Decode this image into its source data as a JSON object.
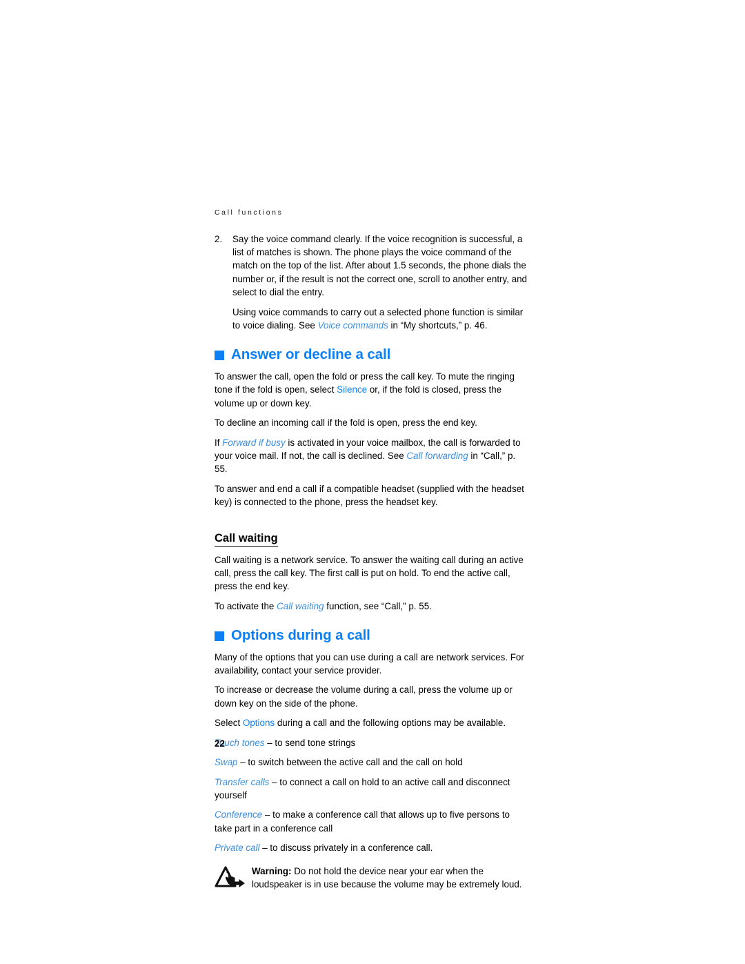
{
  "document": {
    "running_header": "Call functions",
    "page_number": "22"
  },
  "step": {
    "number": "2.",
    "paragraph_1": "Say the voice command clearly. If the voice recognition is successful, a list of matches is shown. The phone plays the voice command of the match on the top of the list. After about 1.5 seconds, the phone dials the number or, if the result is not the correct one, scroll to another entry, and select to dial the entry.",
    "paragraph_2_part1": "Using voice commands to carry out a selected phone function is similar to voice dialing. See ",
    "paragraph_2_term": "Voice commands",
    "paragraph_2_part2": " in “My shortcuts,” p. 46."
  },
  "answer_decline": {
    "heading": "Answer or decline a call",
    "p1_part1": "To answer the call, open the fold or press the call key. To mute the ringing tone if the fold is open, select ",
    "p1_term": "Silence",
    "p1_part2": " or, if the fold is closed, press the volume up or down key.",
    "p2": "To decline an incoming call if the fold is open, press the end key.",
    "p3_part1": "If ",
    "p3_term1": "Forward if busy",
    "p3_part2": " is activated in your voice mailbox, the call is forwarded to your voice mail. If not, the call is declined. See ",
    "p3_term2": "Call forwarding",
    "p3_part3": " in “Call,” p. 55.",
    "p4": "To answer and end a call if a compatible headset (supplied with the headset key) is connected to the phone, press the headset key."
  },
  "call_waiting": {
    "heading": "Call waiting",
    "p1": "Call waiting is a network service. To answer the waiting call during an active call, press the call key. The first call is put on hold. To end the active call, press the end key.",
    "p2_part1": "To activate the ",
    "p2_term": "Call waiting",
    "p2_part2": " function, see “Call,” p. 55."
  },
  "options_during_call": {
    "heading": "Options during a call",
    "p1": "Many of the options that you can use during a call are network services. For availability, contact your service provider.",
    "p2": "To increase or decrease the volume during a call, press the volume up or down key on the side of the phone.",
    "p3_part1": "Select ",
    "p3_term": "Options",
    "p3_part2": " during a call and the following options may be available.",
    "options": [
      {
        "term": "Touch tones",
        "dash": " – ",
        "description": "to send tone strings"
      },
      {
        "term": "Swap",
        "dash": " – ",
        "description": "to switch between the active call and the call on hold"
      },
      {
        "term": "Transfer calls",
        "dash": " – ",
        "description": "to connect a call on hold to an active call and disconnect yourself"
      },
      {
        "term": "Conference",
        "dash": " – ",
        "description": "to make a conference call that allows up to five persons to take part in a conference call"
      },
      {
        "term": "Private call",
        "dash": " – ",
        "description": "to discuss privately in a conference call."
      }
    ]
  },
  "warning": {
    "icon": "warning-triangle-hand-icon",
    "label": "Warning:",
    "text": " Do not hold the device near your ear when the loudspeaker is in use because the volume may be extremely loud."
  },
  "colors": {
    "accent_blue": "#0c7ff2",
    "reference_blue": "#3a8ede",
    "text_black": "#000000",
    "page_background": "#ffffff"
  }
}
